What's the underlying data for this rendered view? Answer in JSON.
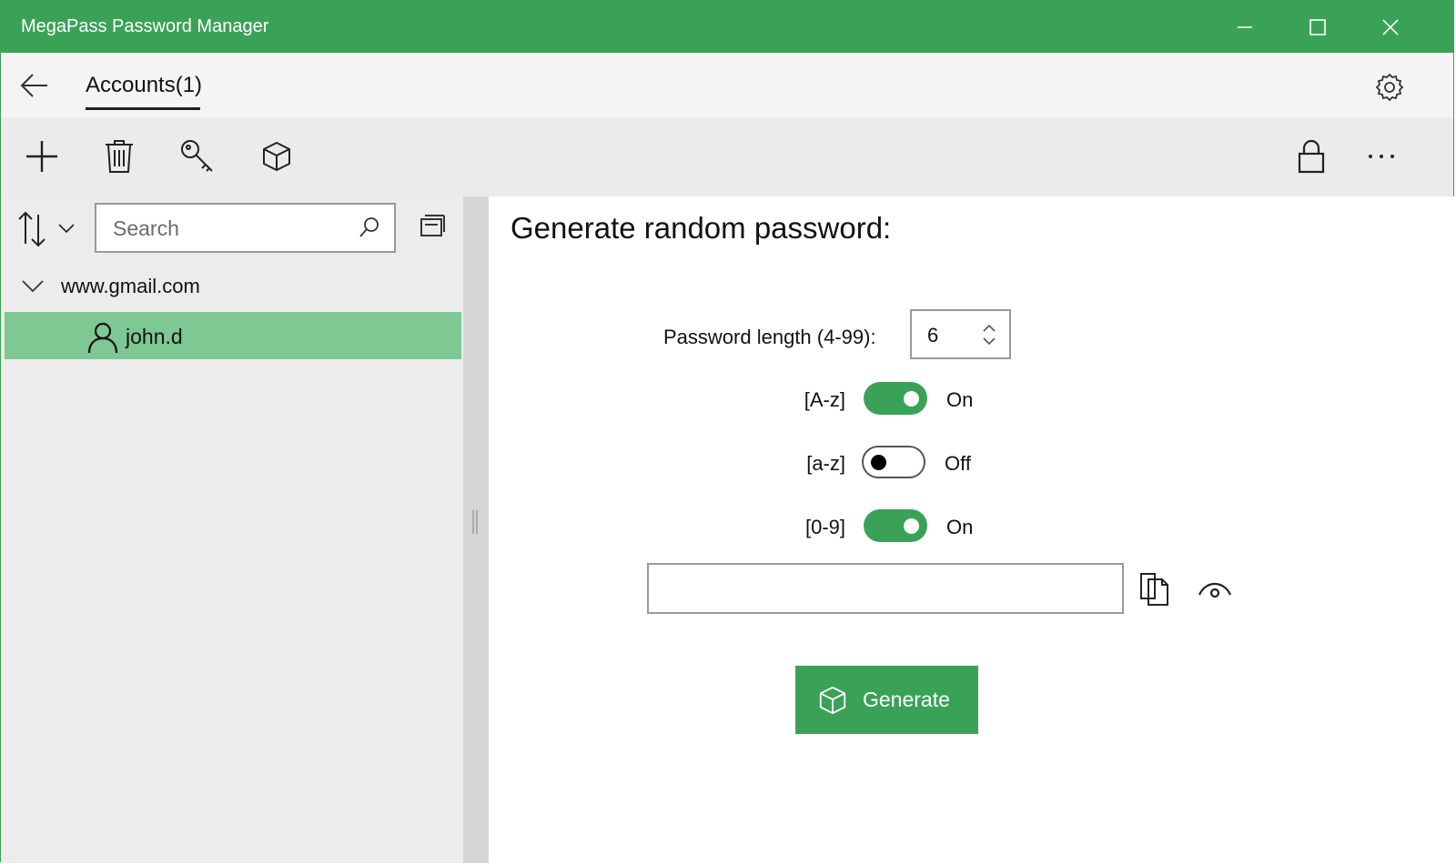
{
  "window": {
    "title": "MegaPass Password Manager",
    "accent_color": "#3aa257",
    "selected_row_color": "#7ec893"
  },
  "nav": {
    "tab_label": "Accounts(1)"
  },
  "toolbar": {
    "icons": [
      "plus-icon",
      "trash-icon",
      "key-icon",
      "cube-icon",
      "lock-icon",
      "more-icon"
    ]
  },
  "sidebar": {
    "search_placeholder": "Search",
    "group": {
      "label": "www.gmail.com",
      "expanded": true
    },
    "accounts": [
      {
        "label": "john.d",
        "selected": true
      }
    ]
  },
  "generator": {
    "heading": "Generate random password:",
    "length_label": "Password length (4-99):",
    "length_value": "6",
    "options": [
      {
        "label": "[A-z]",
        "state": "On",
        "enabled": true
      },
      {
        "label": "[a-z]",
        "state": "Off",
        "enabled": false
      },
      {
        "label": "[0-9]",
        "state": "On",
        "enabled": true
      }
    ],
    "password_value": "",
    "generate_label": "Generate"
  }
}
